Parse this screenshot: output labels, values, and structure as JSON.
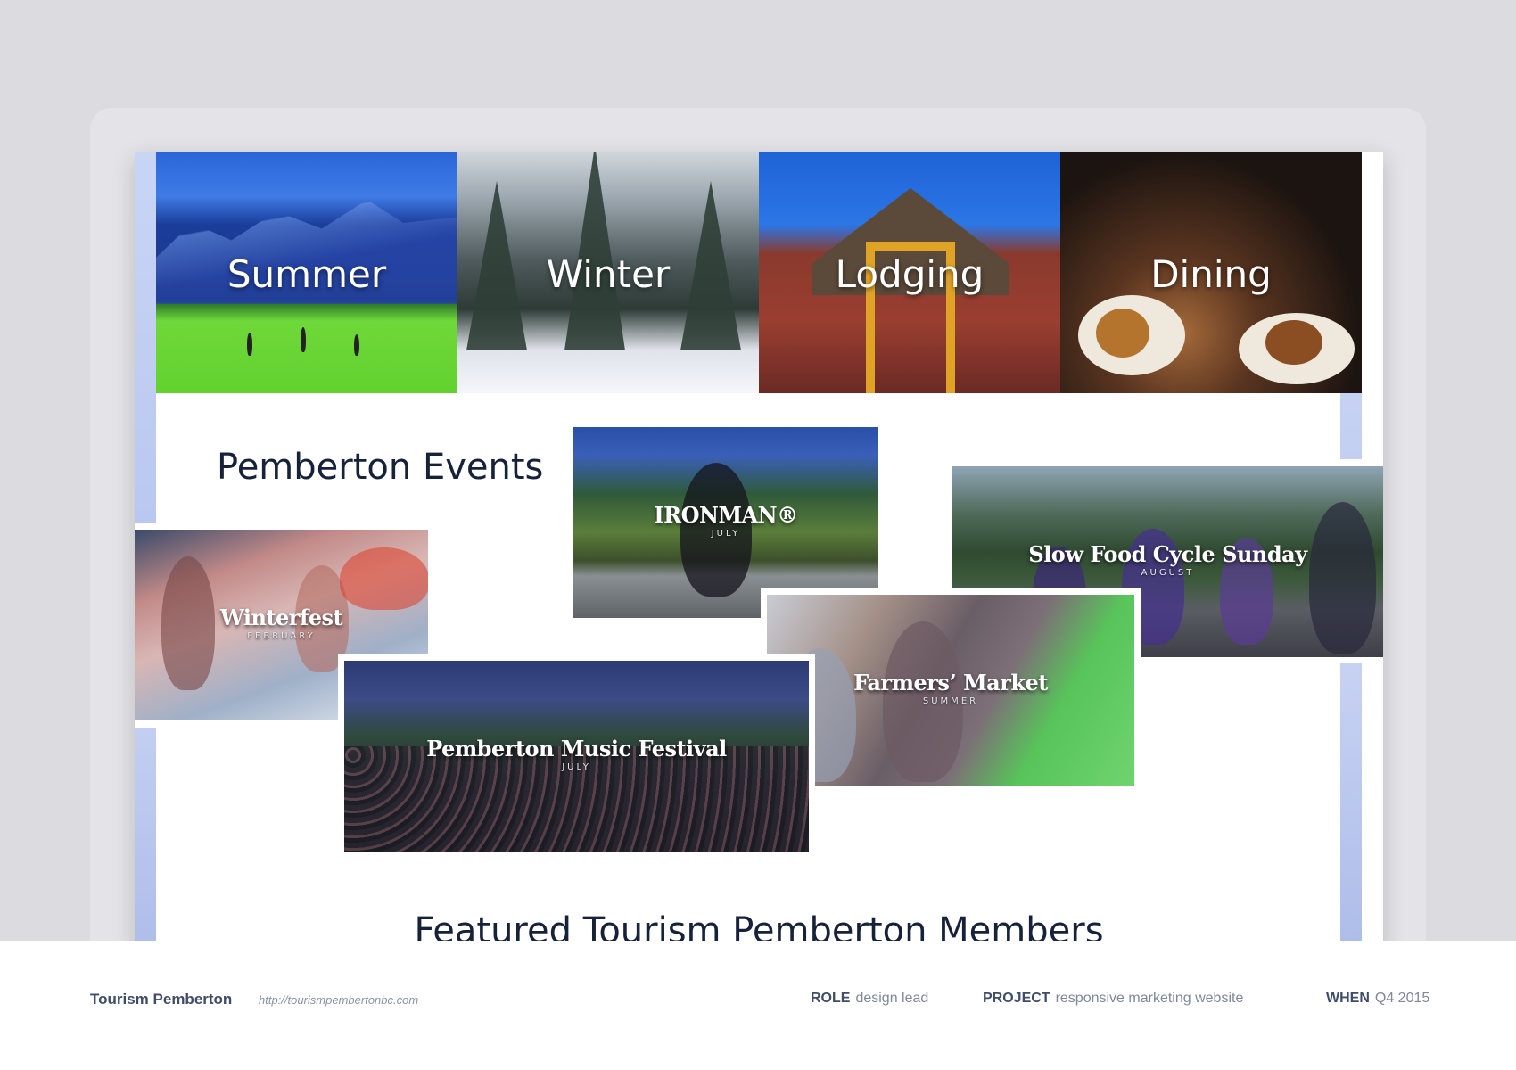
{
  "categories": [
    {
      "label": "Summer"
    },
    {
      "label": "Winter"
    },
    {
      "label": "Lodging"
    },
    {
      "label": "Dining"
    }
  ],
  "events_section": {
    "title": "Pemberton Events",
    "events": {
      "ironman": {
        "name": "IRONMAN®",
        "month": "JULY"
      },
      "slow_food": {
        "name": "Slow Food Cycle Sunday",
        "month": "AUGUST"
      },
      "winterfest": {
        "name": "Winterfest",
        "month": "FEBRUARY"
      },
      "farmers_market": {
        "name": "Farmers’ Market",
        "month": "SUMMER"
      },
      "music_festival": {
        "name": "Pemberton Music Festival",
        "month": "JULY"
      }
    }
  },
  "featured": {
    "title": "Featured Tourism Pemberton Members"
  },
  "caption": {
    "title": "Tourism Pemberton",
    "url": "http://tourismpembertonbc.com",
    "role_label": "ROLE",
    "role_value": "design lead",
    "project_label": "PROJECT",
    "project_value": "responsive marketing website",
    "when_label": "WHEN",
    "when_value": "Q4 2015"
  },
  "colors": {
    "page_background": "#dcdce0",
    "accent_stripe": "#b9c8f0",
    "heading_text": "#16213a"
  }
}
